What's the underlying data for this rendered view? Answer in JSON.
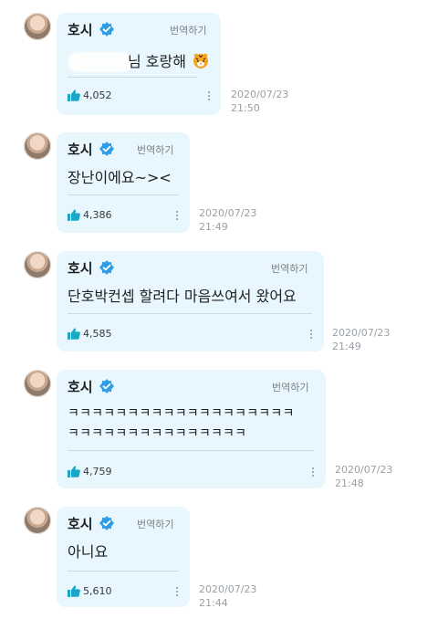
{
  "messages": [
    {
      "name": "호시",
      "translate": "번역하기",
      "text": "님 호랑해",
      "likes": "4,052",
      "date": "2020/07/23",
      "time": "21:50"
    },
    {
      "name": "호시",
      "translate": "번역하기",
      "text": "장난이에요~><",
      "likes": "4,386",
      "date": "2020/07/23",
      "time": "21:49"
    },
    {
      "name": "호시",
      "translate": "번역하기",
      "text": "단호박컨셉 할려다 마음쓰여서 왔어요",
      "likes": "4,585",
      "date": "2020/07/23",
      "time": "21:49"
    },
    {
      "name": "호시",
      "translate": "번역하기",
      "text_lines": [
        "ㅋㅋㅋㅋㅋㅋㅋㅋㅋㅋㅋㅋㅋㅋㅋㅋㅋㅋㅋ",
        "ㅋㅋㅋㅋㅋㅋㅋㅋㅋㅋㅋㅋㅋㅋㅋ"
      ],
      "likes": "4,759",
      "date": "2020/07/23",
      "time": "21:48"
    },
    {
      "name": "호시",
      "translate": "번역하기",
      "text": "아니요",
      "likes": "5,610",
      "date": "2020/07/23",
      "time": "21:44"
    }
  ],
  "colors": {
    "bubble": "#e8f7fd",
    "verified": "#2f9de4",
    "like": "#1aa7c5"
  },
  "icons": {
    "verified": "verified-badge-icon",
    "like": "thumbs-up-icon",
    "more": "more-vertical-icon",
    "tiger_emoji": "tiger-emoji-icon"
  }
}
